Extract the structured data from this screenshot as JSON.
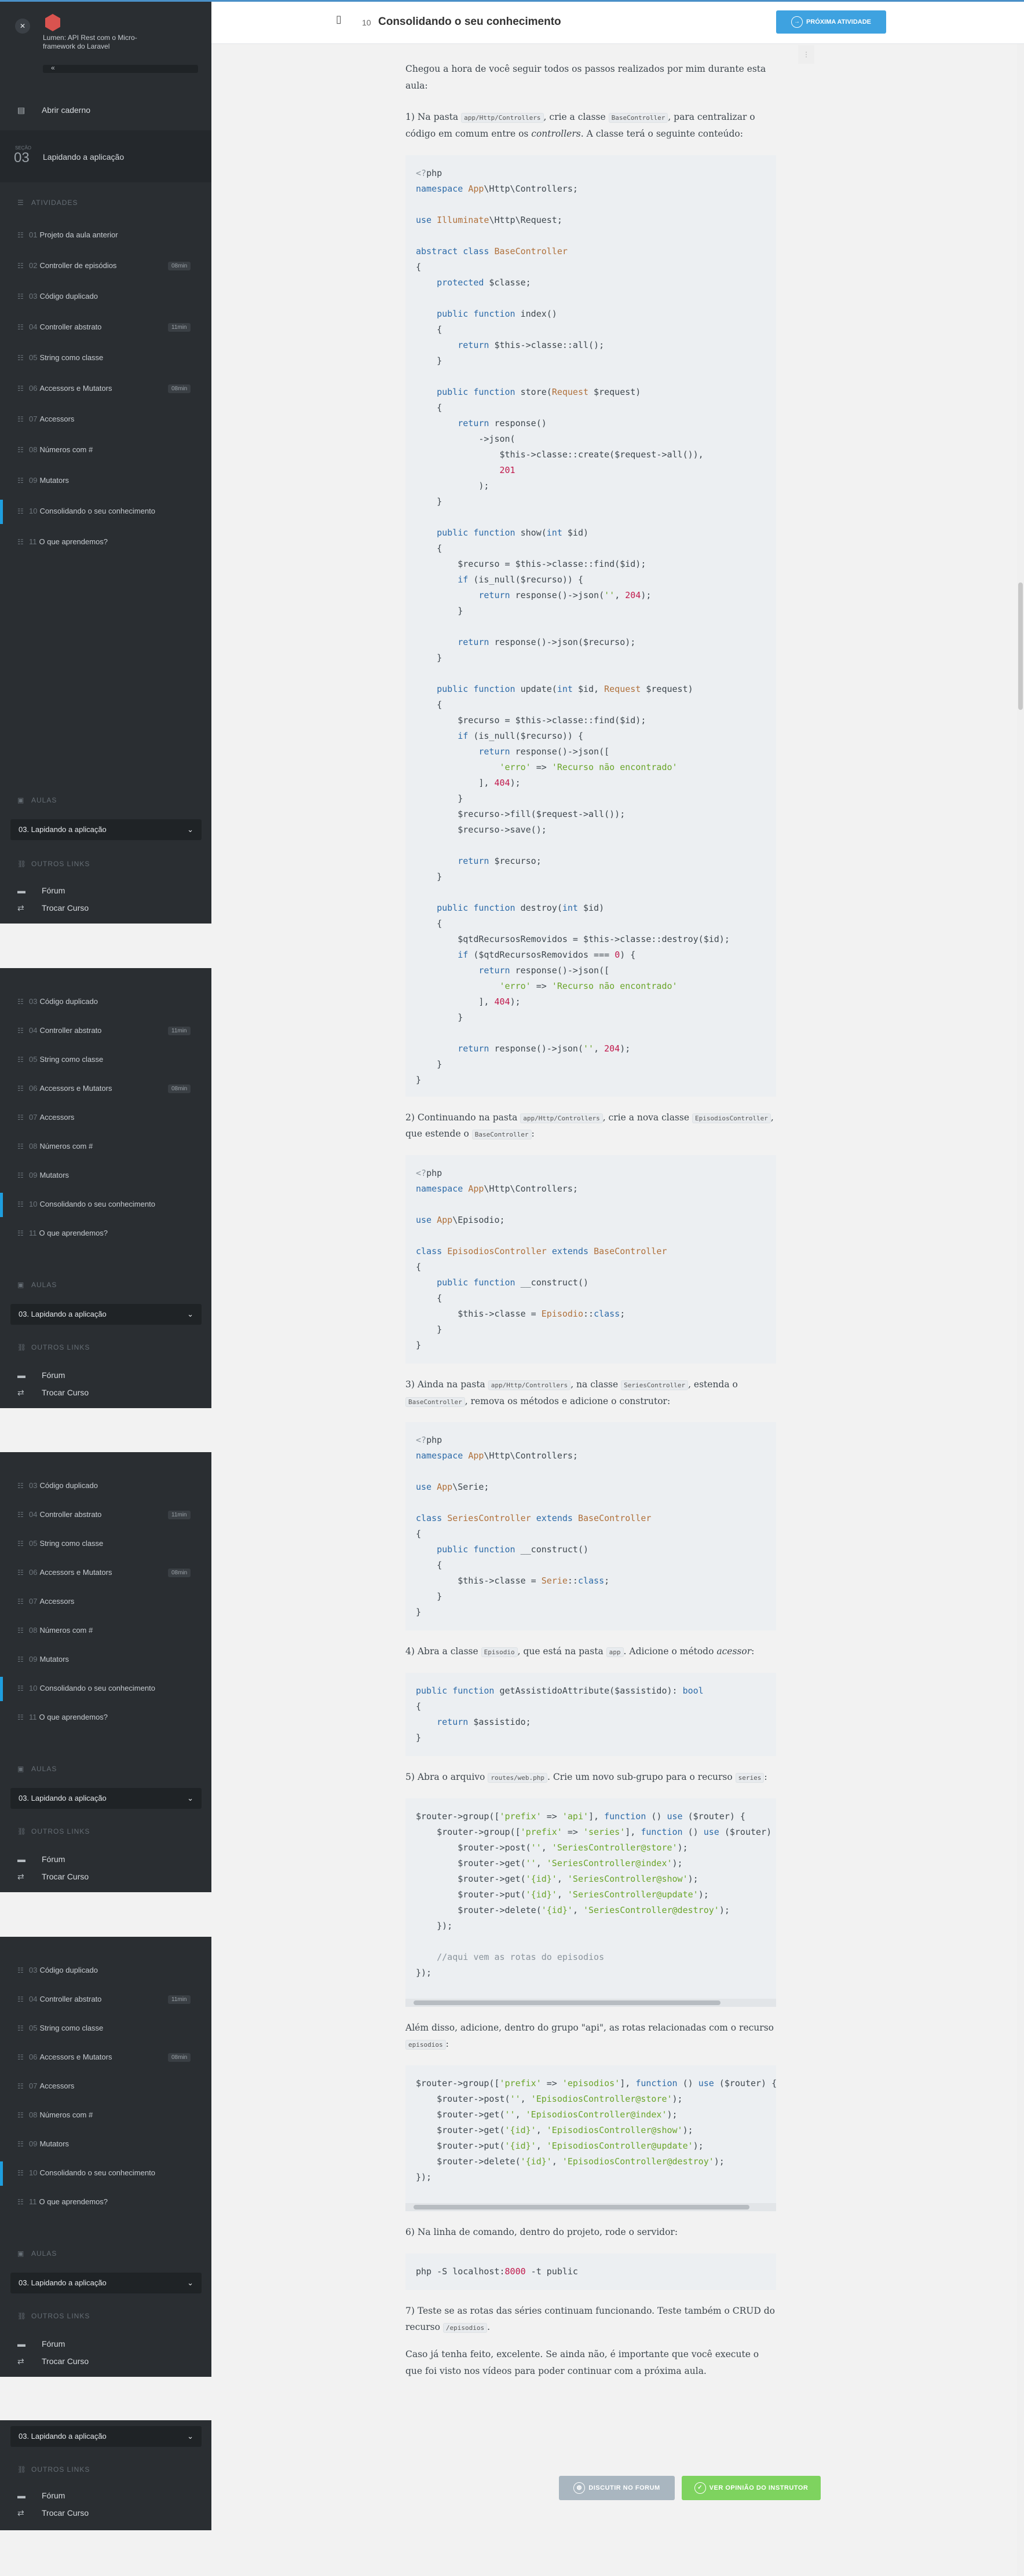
{
  "course": {
    "title": "Lumen: API Rest com o Micro-framework do Laravel",
    "back_label": "«"
  },
  "sidebar": {
    "notebook": "Abrir caderno",
    "section_number": "03",
    "section_prefix": "SEÇÃO",
    "section_title": "Lapidando a aplicação",
    "activities_header": "ATIVIDADES",
    "lessons_header": "AULAS",
    "lesson_select": "03. Lapidando a aplicação",
    "other_links_header": "OUTROS LINKS",
    "forum": "Fórum",
    "switch_course": "Trocar Curso"
  },
  "activities": [
    {
      "num": "01",
      "label": "Projeto da aula anterior",
      "badge": ""
    },
    {
      "num": "02",
      "label": "Controller de episódios",
      "badge": "08min"
    },
    {
      "num": "03",
      "label": "Código duplicado",
      "badge": ""
    },
    {
      "num": "04",
      "label": "Controller abstrato",
      "badge": "11min"
    },
    {
      "num": "05",
      "label": "String como classe",
      "badge": ""
    },
    {
      "num": "06",
      "label": "Accessors e Mutators",
      "badge": "08min"
    },
    {
      "num": "07",
      "label": "Accessors",
      "badge": ""
    },
    {
      "num": "08",
      "label": "Números com #",
      "badge": ""
    },
    {
      "num": "09",
      "label": "Mutators",
      "badge": ""
    },
    {
      "num": "10",
      "label": "Consolidando o seu conhecimento",
      "badge": ""
    },
    {
      "num": "11",
      "label": "O que aprendemos?",
      "badge": ""
    }
  ],
  "header": {
    "activity_num": "10",
    "title": "Consolidando o seu conhecimento",
    "next_button": "PRÓXIMA ATIVIDADE"
  },
  "content": {
    "intro": "Chegou a hora de você seguir todos os passos realizados por mim durante esta aula:",
    "step1_a": "1) Na pasta ",
    "step1_code1": "app/Http/Controllers",
    "step1_b": ", crie a classe ",
    "step1_code2": "BaseController",
    "step1_c": ", para centralizar o código em comum entre os ",
    "step1_em": "controllers",
    "step1_d": ". A classe terá o seguinte conteúdo:",
    "step2_a": "2) Continuando na pasta ",
    "step2_code1": "app/Http/Controllers",
    "step2_b": ", crie a nova classe ",
    "step2_code2": "EpisodiosController",
    "step2_c": ", que estende o ",
    "step2_code3": "BaseController",
    "step2_d": ":",
    "step3_a": "3) Ainda na pasta ",
    "step3_code1": "app/Http/Controllers",
    "step3_b": ", na classe ",
    "step3_code2": "SeriesController",
    "step3_c": ", estenda o ",
    "step3_code3": "BaseController",
    "step3_d": ", remova os métodos e adicione o construtor:",
    "step4_a": "4) Abra a classe ",
    "step4_code1": "Episodio",
    "step4_b": ", que está na pasta ",
    "step4_code2": "app",
    "step4_c": ". Adicione o método ",
    "step4_em": "acessor",
    "step4_d": ":",
    "step5_a": "5) Abra o arquivo ",
    "step5_code1": "routes/web.php",
    "step5_b": ". Crie um novo sub-grupo para o recurso ",
    "step5_code2": "series",
    "step5_c": ":",
    "step5b_a": "Além disso, adicione, dentro do grupo \"api\", as rotas relacionadas com o recurso ",
    "step5b_code": "episodios",
    "step5b_b": ":",
    "step6": "6) Na linha de comando, dentro do projeto, rode o servidor:",
    "step7_a": "7) Teste se as rotas das séries continuam funcionando. Teste também o CRUD do recurso ",
    "step7_code": "/episodios",
    "step7_b": ".",
    "outro": "Caso já tenha feito, excelente. Se ainda não, é importante que você execute o que foi visto nos vídeos para poder continuar com a próxima aula."
  },
  "buttons": {
    "forum": "DISCUTIR NO FORUM",
    "instructor": "VER OPINIÃO DO INSTRUTOR"
  },
  "colors": {
    "sidebar_bg": "#2a2e32",
    "accent": "#1e9ede",
    "forum_button": "#a9b6c0",
    "instructor_button": "#7ed35f"
  },
  "icons": [
    "close-icon",
    "notebook-icon",
    "list-icon",
    "lessons-icon",
    "links-icon",
    "forum-icon",
    "switch-icon",
    "book-icon",
    "arrow-right-icon",
    "globe-icon",
    "check-icon",
    "chevron-down-icon"
  ]
}
